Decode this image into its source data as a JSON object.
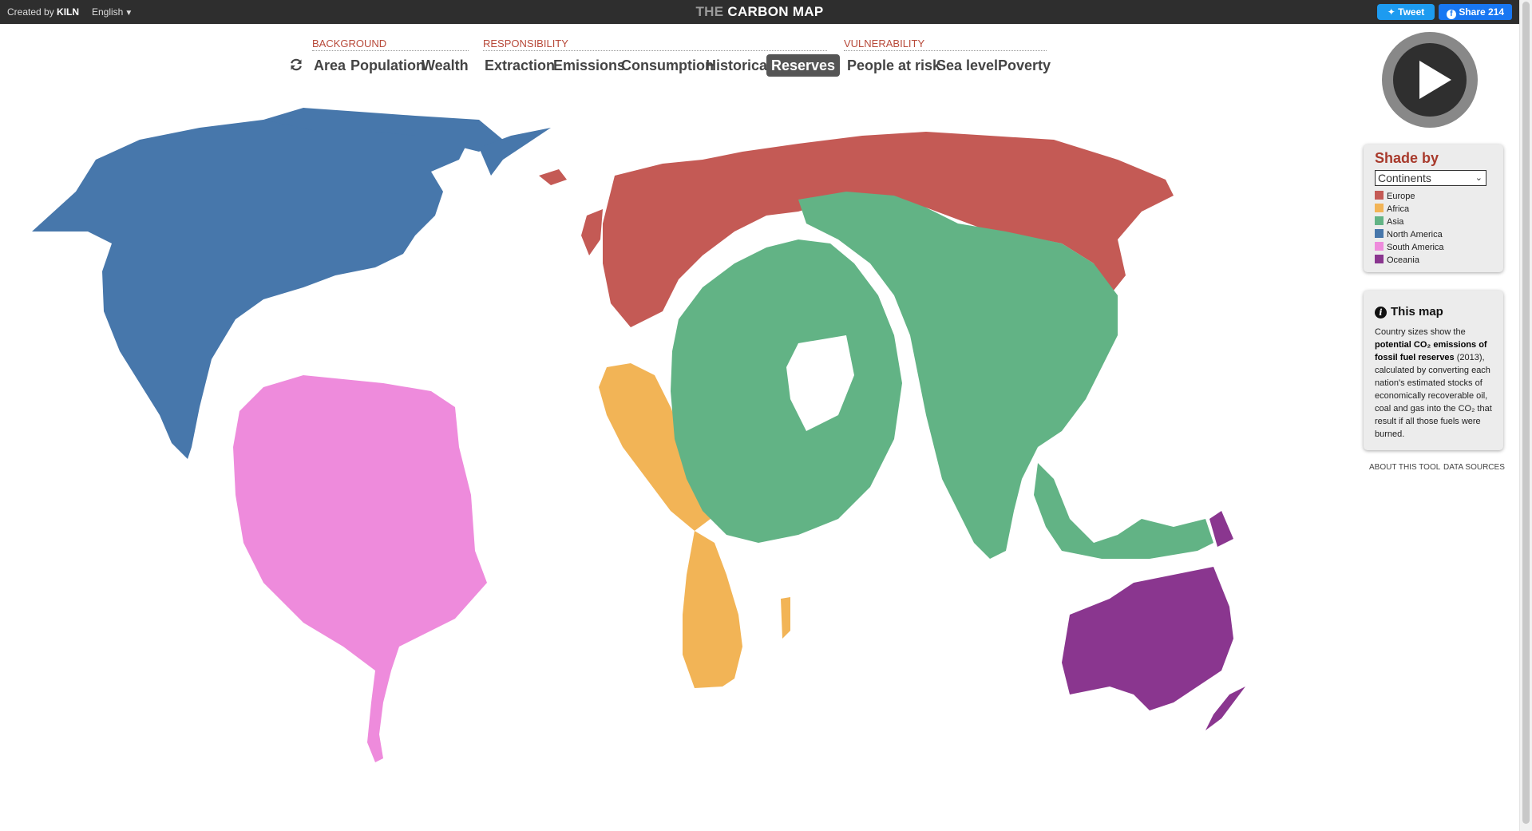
{
  "header": {
    "created_by_prefix": "Created by",
    "created_by_brand": "KILN",
    "language": "English",
    "title_prefix": "THE",
    "title_main": "CARBON MAP",
    "tweet_label": "Tweet",
    "share_label": "Share 214"
  },
  "nav": {
    "background_label": "BACKGROUND",
    "responsibility_label": "RESPONSIBILITY",
    "vulnerability_label": "VULNERABILITY",
    "area": "Area",
    "population": "Population",
    "wealth": "Wealth",
    "extraction": "Extraction",
    "emissions": "Emissions",
    "consumption": "Consumption",
    "historical": "Historical",
    "reserves": "Reserves",
    "people_at_risk": "People at risk",
    "sea_level": "Sea level",
    "poverty": "Poverty",
    "active": "Reserves"
  },
  "shade": {
    "title": "Shade by",
    "selected": "Continents",
    "legend": [
      {
        "label": "Europe",
        "color": "#c45a55"
      },
      {
        "label": "Africa",
        "color": "#f2b456"
      },
      {
        "label": "Asia",
        "color": "#62b385"
      },
      {
        "label": "North America",
        "color": "#4777ab"
      },
      {
        "label": "South America",
        "color": "#ee8bdc"
      },
      {
        "label": "Oceania",
        "color": "#8a368f"
      }
    ]
  },
  "info": {
    "title": "This map",
    "text_before": "Country sizes show the",
    "text_bold": "potential CO₂ emissions of fossil fuel reserves",
    "text_after": "(2013), calculated by converting each nation's estimated stocks of economically recoverable oil, coal and gas into the CO₂ that result if all those fuels were burned."
  },
  "footer": {
    "about": "ABOUT THIS TOOL",
    "sources": "DATA SOURCES"
  }
}
